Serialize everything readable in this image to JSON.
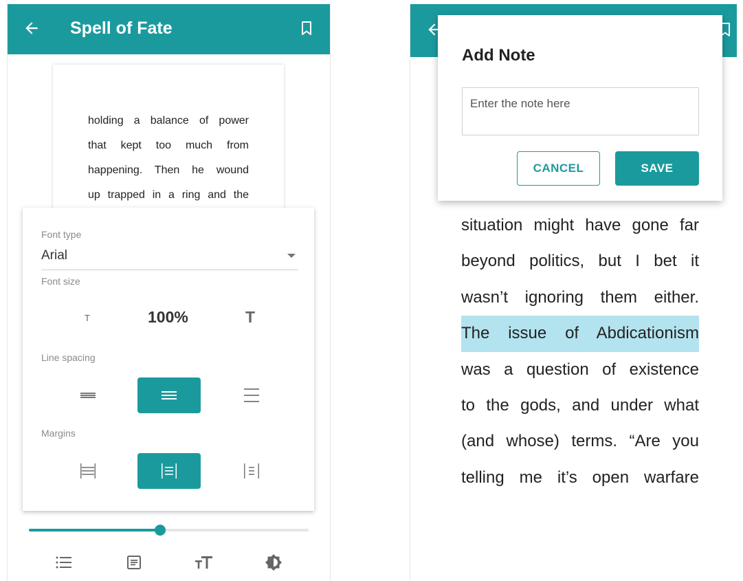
{
  "colors": {
    "accent": "#1b9a9e",
    "highlight": "#b3e3ef"
  },
  "left": {
    "appbar": {
      "title": "Spell of Fate",
      "back_icon": "arrow-left-icon",
      "bookmark_icon": "bookmark-icon"
    },
    "page_lines": [
      "holding a balance of power",
      "that kept too much from",
      "happening. Then he wound",
      "up trapped in a ring and the"
    ],
    "settings": {
      "font_type_label": "Font type",
      "font_type_value": "Arial",
      "font_size_label": "Font size",
      "font_size_small_glyph": "T",
      "font_size_value": "100%",
      "font_size_large_glyph": "T",
      "line_spacing_label": "Line spacing",
      "line_spacing_selected": "normal",
      "margins_label": "Margins",
      "margins_selected": "medium"
    },
    "progress": 0.47,
    "bottom_tools": [
      "list-icon",
      "article-icon",
      "text-size-icon",
      "brightness-icon"
    ]
  },
  "right": {
    "appbar": {
      "back_icon": "arrow-left-icon",
      "bookmark_icon": "bookmark-icon"
    },
    "dialog": {
      "title": "Add Note",
      "placeholder": "Enter the note here",
      "cancel_label": "CANCEL",
      "save_label": "SAVE"
    },
    "reader_lines": [
      "situation might have gone far",
      "beyond politics, but I bet it",
      "wasn’t ignoring them either.",
      "The issue of Abdicationism",
      "was a question of existence",
      "to the gods, and under what",
      "(and whose) terms. “Are you",
      "telling me it’s open warfare"
    ],
    "highlighted_line_index": 3
  }
}
